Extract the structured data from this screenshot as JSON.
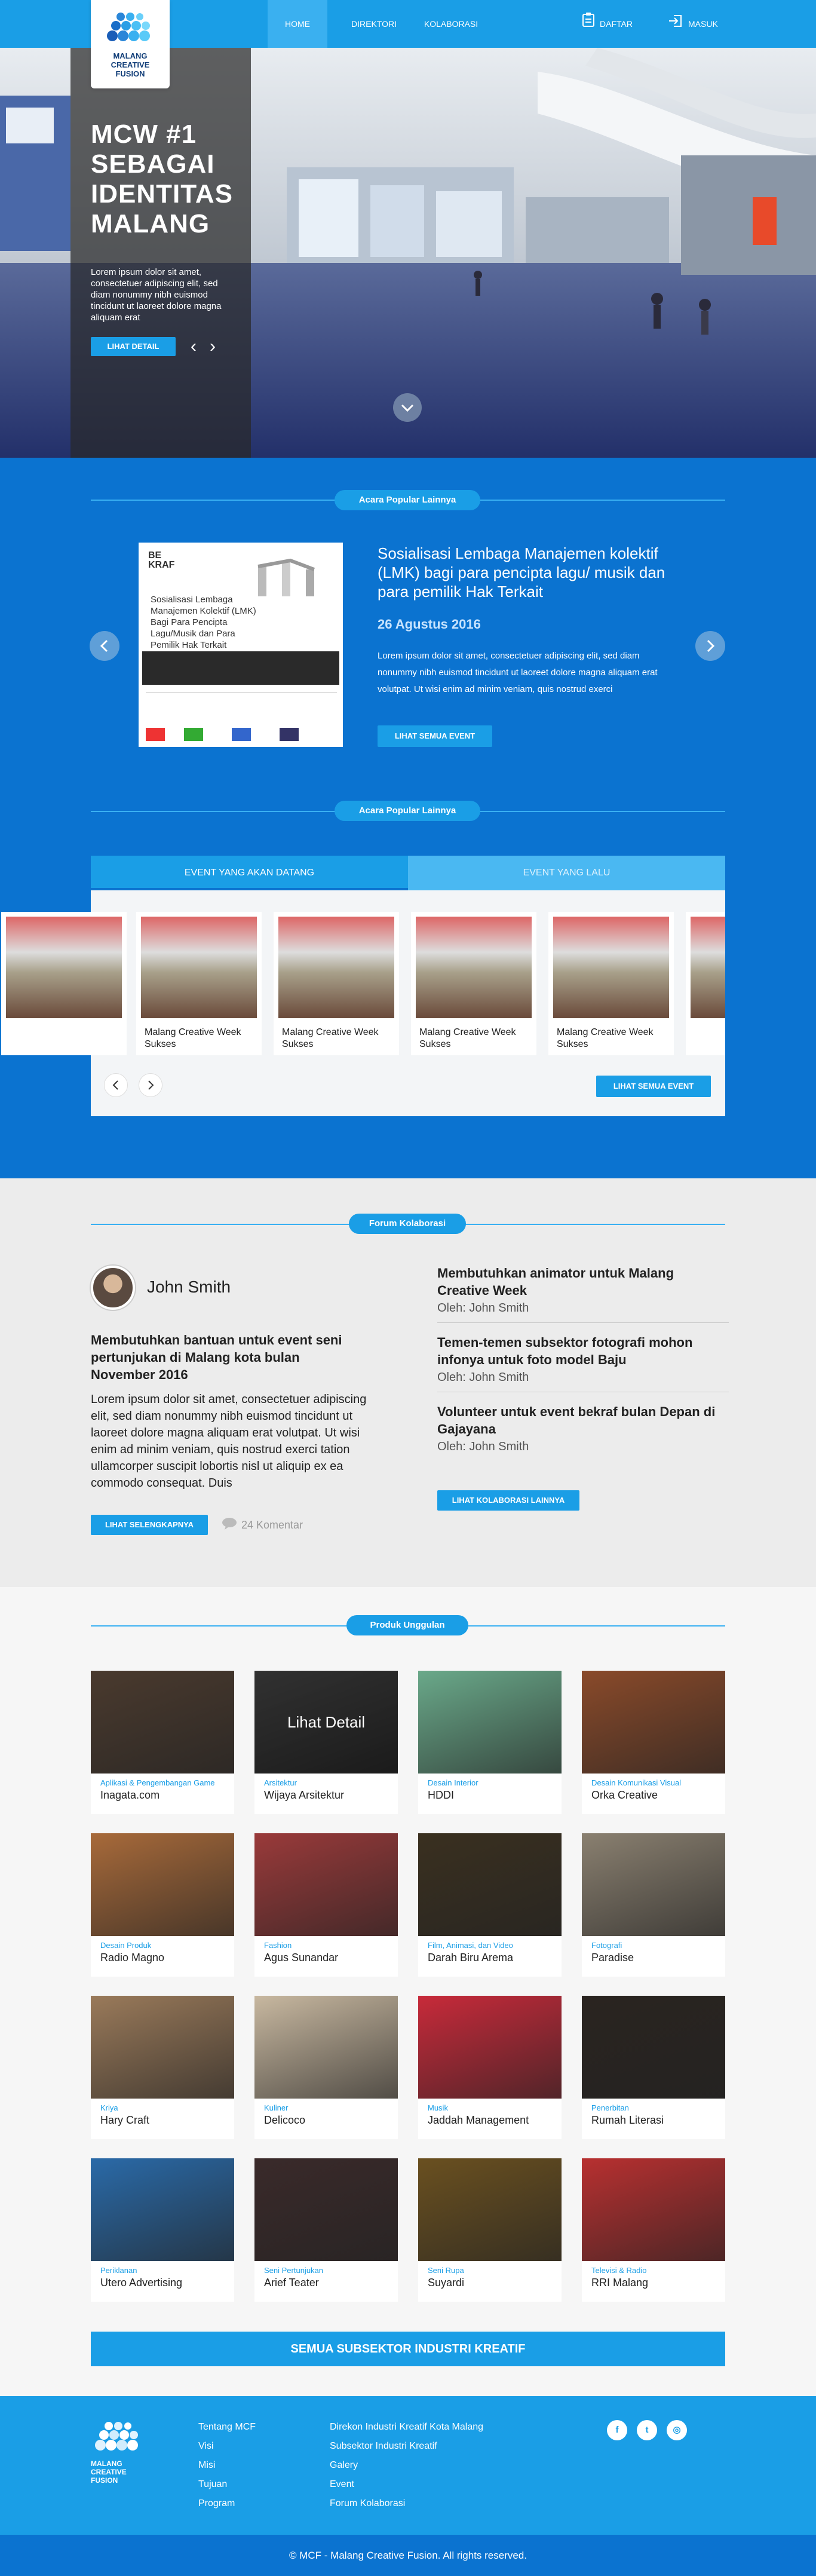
{
  "brand": {
    "logo_text": "MALANG\nCREATIVE\nFUSION",
    "primary_color": "#1a9ee6",
    "dark_color": "#0b73d0"
  },
  "nav": {
    "items": [
      {
        "label": "HOME",
        "active": true
      },
      {
        "label": "DIREKTORI",
        "active": false
      },
      {
        "label": "KOLABORASI",
        "active": false
      }
    ],
    "register": {
      "label": "DAFTAR",
      "icon": "clipboard-icon"
    },
    "login": {
      "label": "MASUK",
      "icon": "login-arrow-icon"
    }
  },
  "hero": {
    "title": "MCW #1 SEBAGAI IDENTITAS MALANG",
    "description": "Lorem ipsum dolor sit amet, consectetuer adipiscing elit, sed diam nonummy nibh euismod tincidunt ut laoreet dolore magna aliquam erat",
    "cta": "LIHAT DETAIL",
    "prev": "‹",
    "next": "›"
  },
  "featured": {
    "heading": "Acara Popular Lainnya",
    "poster": {
      "logo": "BE KRAF",
      "title": "Sosialisasi Lembaga Manajemen Kolektif (LMK) Bagi Para Pencipta Lagu/Musik dan Para Pemilik Hak Terkait"
    },
    "title": "Sosialisasi Lembaga Manajemen kolektif (LMK) bagi para pencipta lagu/ musik dan para pemilik Hak Terkait",
    "date": "26 Agustus 2016",
    "description": "Lorem ipsum dolor sit amet, consectetuer adipiscing elit, sed diam nonummy nibh euismod tincidunt ut laoreet dolore magna aliquam erat volutpat. Ut wisi enim ad minim veniam, quis nostrud exerci",
    "cta": "LIHAT SEMUA EVENT"
  },
  "events": {
    "heading": "Acara Popular Lainnya",
    "tabs": [
      {
        "label": "EVENT YANG AKAN DATANG",
        "active": true
      },
      {
        "label": "EVENT YANG LALU",
        "active": false
      }
    ],
    "cards": [
      {
        "title": "Malang Creative Week Sukses"
      },
      {
        "title": "Malang Creative Week Sukses"
      },
      {
        "title": "Malang Creative Week Sukses"
      },
      {
        "title": "Malang Creative Week Sukses"
      }
    ],
    "cta": "LIHAT SEMUA EVENT"
  },
  "forum": {
    "heading": "Forum Kolaborasi",
    "author": "John Smith",
    "post_title": "Membutuhkan bantuan untuk event seni pertunjukan di Malang kota bulan November 2016",
    "post_body": "Lorem ipsum dolor sit amet, consectetuer adipiscing elit, sed diam nonummy nibh euismod tincidunt ut laoreet dolore magna aliquam erat volutpat. Ut wisi enim ad minim veniam, quis nostrud exerci tation ullamcorper suscipit lobortis nisl ut aliquip ex ea commodo consequat. Duis",
    "read_more": "LIHAT SELENGKAPNYA",
    "comments": "24 Komentar",
    "list": [
      {
        "title": "Membutuhkan animator untuk Malang Creative Week",
        "meta": "Oleh: John Smith"
      },
      {
        "title": "Temen-temen subsektor fotografi mohon infonya untuk foto model Baju",
        "meta": "Oleh: John Smith"
      },
      {
        "title": "Volunteer untuk event bekraf bulan Depan di Gajayana",
        "meta": "Oleh: John Smith"
      }
    ],
    "cta": "LIHAT KOLABORASI LAINNYA"
  },
  "products": {
    "heading": "Produk Unggulan",
    "hover_label": "Lihat Detail",
    "items": [
      {
        "category": "Aplikasi & Pengembangan Game",
        "name": "Inagata.com",
        "color": "#4a3a2e"
      },
      {
        "category": "Arsitektur",
        "name": "Wijaya Arsitektur",
        "color": "#5a5a5a"
      },
      {
        "category": "Desain Interior",
        "name": "HDDI",
        "color": "#6aa98a"
      },
      {
        "category": "Desain Komunikasi Visual",
        "name": "Orka Creative",
        "color": "#8a4a2a"
      },
      {
        "category": "Desain Produk",
        "name": "Radio Magno",
        "color": "#a86a3a"
      },
      {
        "category": "Fashion",
        "name": "Agus Sunandar",
        "color": "#9a3a3a"
      },
      {
        "category": "Film, Animasi, dan Video",
        "name": "Darah Biru Arema",
        "color": "#3a3020"
      },
      {
        "category": "Fotografi",
        "name": "Paradise",
        "color": "#8a8070"
      },
      {
        "category": "Kriya",
        "name": "Hary Craft",
        "color": "#9a7a5a"
      },
      {
        "category": "Kuliner",
        "name": "Delicoco",
        "color": "#c8b8a0"
      },
      {
        "category": "Musik",
        "name": "Jaddah Management",
        "color": "#c82a3a"
      },
      {
        "category": "Penerbitan",
        "name": "Rumah Literasi",
        "color": "#2a2420"
      },
      {
        "category": "Periklanan",
        "name": "Utero Advertising",
        "color": "#2a6aa8"
      },
      {
        "category": "Seni Pertunjukan",
        "name": "Arief Teater",
        "color": "#3a2a2a"
      },
      {
        "category": "Seni Rupa",
        "name": "Suyardi",
        "color": "#6a5020"
      },
      {
        "category": "Televisi & Radio",
        "name": "RRI Malang",
        "color": "#b83030"
      }
    ],
    "all_button": "SEMUA SUBSEKTOR INDUSTRI KREATIF"
  },
  "footer": {
    "col1": [
      "Tentang MCF",
      "Visi",
      "Misi",
      "Tujuan",
      "Program"
    ],
    "col2": [
      "Direkon Industri Kreatif Kota Malang",
      "Subsektor Industri Kreatif",
      "Galery",
      "Event",
      "Forum Kolaborasi"
    ],
    "social": [
      {
        "icon": "facebook-icon",
        "glyph": "f"
      },
      {
        "icon": "twitter-icon",
        "glyph": "t"
      },
      {
        "icon": "instagram-icon",
        "glyph": "◎"
      }
    ],
    "copyright": "© MCF - Malang Creative Fusion. All rights reserved."
  }
}
